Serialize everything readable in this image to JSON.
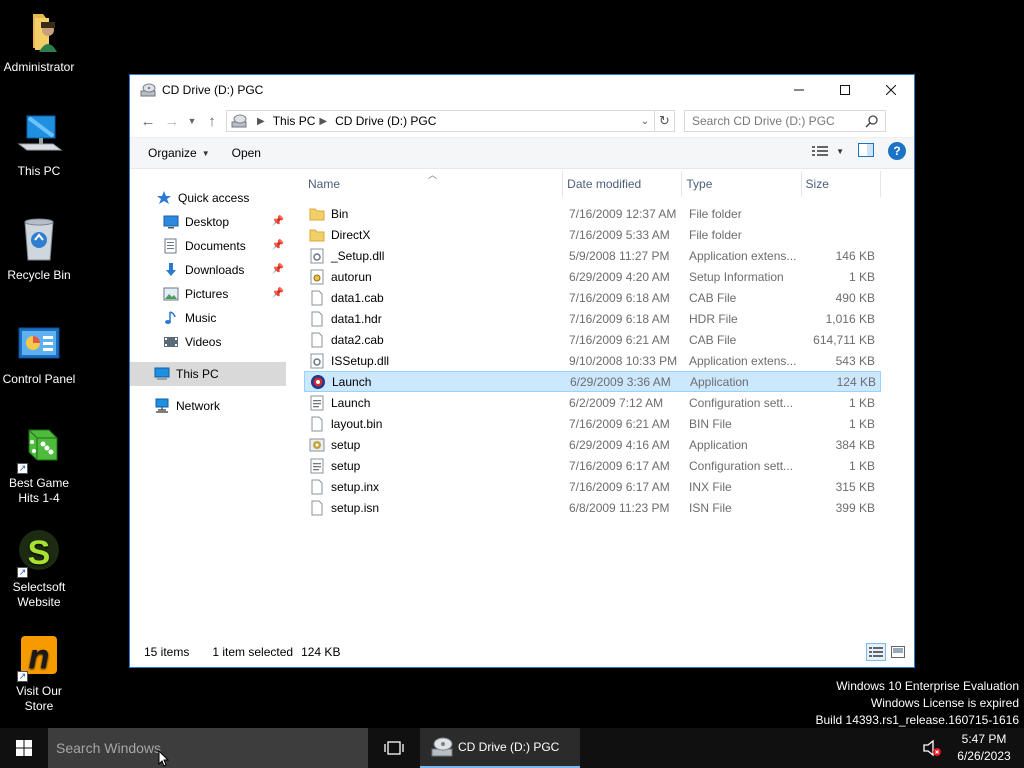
{
  "desktop": {
    "icons": [
      {
        "label": "Administrator",
        "icon": "user-folder-icon"
      },
      {
        "label": "This PC",
        "icon": "computer-icon"
      },
      {
        "label": "Recycle Bin",
        "icon": "recycle-bin-icon"
      },
      {
        "label": "Control Panel",
        "icon": "control-panel-icon"
      },
      {
        "label": "Best Game\nHits 1-4",
        "icon": "dice-icon"
      },
      {
        "label": "Selectsoft\nWebsite",
        "icon": "selectsoft-icon"
      },
      {
        "label": "Visit Our\nStore",
        "icon": "store-icon"
      }
    ]
  },
  "window": {
    "title": "CD Drive (D:) PGC",
    "controls": {
      "minimize": "—",
      "maximize": "☐",
      "close": "✕"
    },
    "breadcrumb": [
      "This PC",
      "CD Drive (D:) PGC"
    ],
    "search_placeholder": "Search CD Drive (D:) PGC",
    "toolbar": {
      "organize": "Organize",
      "open": "Open"
    },
    "nav": {
      "quick_access": "Quick access",
      "items": [
        {
          "label": "Desktop",
          "pinned": true
        },
        {
          "label": "Documents",
          "pinned": true
        },
        {
          "label": "Downloads",
          "pinned": true
        },
        {
          "label": "Pictures",
          "pinned": true
        },
        {
          "label": "Music",
          "pinned": false
        },
        {
          "label": "Videos",
          "pinned": false
        }
      ],
      "this_pc": "This PC",
      "network": "Network"
    },
    "columns": {
      "name": "Name",
      "date": "Date modified",
      "type": "Type",
      "size": "Size"
    },
    "files": [
      {
        "name": "Bin",
        "date": "7/16/2009 12:37 AM",
        "type": "File folder",
        "size": "",
        "icon": "folder"
      },
      {
        "name": "DirectX",
        "date": "7/16/2009 5:33 AM",
        "type": "File folder",
        "size": "",
        "icon": "folder"
      },
      {
        "name": "_Setup.dll",
        "date": "5/9/2008 11:27 PM",
        "type": "Application extens...",
        "size": "146 KB",
        "icon": "dll"
      },
      {
        "name": "autorun",
        "date": "6/29/2009 4:20 AM",
        "type": "Setup Information",
        "size": "1 KB",
        "icon": "setup-info"
      },
      {
        "name": "data1.cab",
        "date": "7/16/2009 6:18 AM",
        "type": "CAB File",
        "size": "490 KB",
        "icon": "file"
      },
      {
        "name": "data1.hdr",
        "date": "7/16/2009 6:18 AM",
        "type": "HDR File",
        "size": "1,016 KB",
        "icon": "file"
      },
      {
        "name": "data2.cab",
        "date": "7/16/2009 6:21 AM",
        "type": "CAB File",
        "size": "614,711 KB",
        "icon": "file"
      },
      {
        "name": "ISSetup.dll",
        "date": "9/10/2008 10:33 PM",
        "type": "Application extens...",
        "size": "543 KB",
        "icon": "dll"
      },
      {
        "name": "Launch",
        "date": "6/29/2009 3:36 AM",
        "type": "Application",
        "size": "124 KB",
        "icon": "launch-app",
        "selected": true
      },
      {
        "name": "Launch",
        "date": "6/2/2009 7:12 AM",
        "type": "Configuration sett...",
        "size": "1 KB",
        "icon": "config"
      },
      {
        "name": "layout.bin",
        "date": "7/16/2009 6:21 AM",
        "type": "BIN File",
        "size": "1 KB",
        "icon": "file"
      },
      {
        "name": "setup",
        "date": "6/29/2009 4:16 AM",
        "type": "Application",
        "size": "384 KB",
        "icon": "setup-app"
      },
      {
        "name": "setup",
        "date": "7/16/2009 6:17 AM",
        "type": "Configuration sett...",
        "size": "1 KB",
        "icon": "config"
      },
      {
        "name": "setup.inx",
        "date": "7/16/2009 6:17 AM",
        "type": "INX File",
        "size": "315 KB",
        "icon": "file"
      },
      {
        "name": "setup.isn",
        "date": "6/8/2009 11:23 PM",
        "type": "ISN File",
        "size": "399 KB",
        "icon": "file"
      }
    ],
    "status": {
      "count": "15 items",
      "selection": "1 item selected",
      "size": "124 KB"
    }
  },
  "watermark": {
    "line1": "Windows 10 Enterprise Evaluation",
    "line2": "Windows License is expired",
    "line3": "Build 14393.rs1_release.160715-1616"
  },
  "taskbar": {
    "search_placeholder": "Search Windows",
    "app_label": "CD Drive (D:) PGC",
    "time": "5:47 PM",
    "date": "6/26/2023"
  },
  "colors": {
    "accent": "#2b79d0",
    "selection": "#cce8ff",
    "taskbar": "#101010"
  }
}
